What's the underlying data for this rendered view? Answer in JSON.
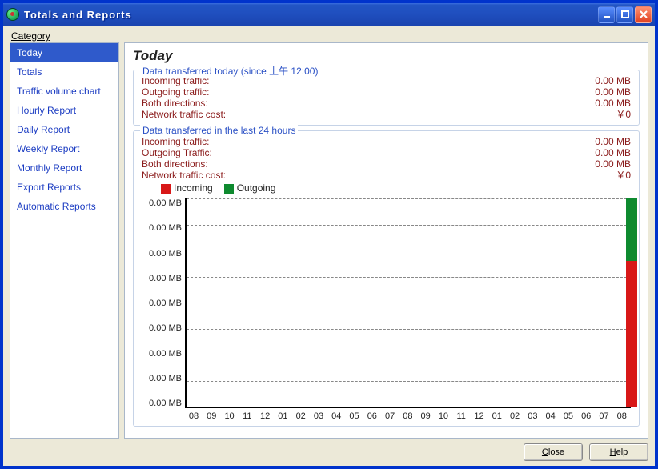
{
  "window": {
    "title": "Totals and Reports"
  },
  "category_label": "Category",
  "sidebar": {
    "items": [
      {
        "label": "Today",
        "selected": true
      },
      {
        "label": "Totals"
      },
      {
        "label": "Traffic volume chart"
      },
      {
        "label": "Hourly Report"
      },
      {
        "label": "Daily Report"
      },
      {
        "label": "Weekly Report"
      },
      {
        "label": "Monthly Report"
      },
      {
        "label": "Export Reports"
      },
      {
        "label": "Automatic Reports"
      }
    ]
  },
  "page": {
    "title": "Today",
    "group_today": {
      "legend": "Data transferred today (since 上午 12:00)",
      "rows": [
        {
          "k": "Incoming traffic:",
          "v": "0.00 MB"
        },
        {
          "k": "Outgoing traffic:",
          "v": "0.00 MB"
        },
        {
          "k": "Both directions:",
          "v": "0.00 MB"
        },
        {
          "k": "Network traffic cost:",
          "v": "￥0"
        }
      ]
    },
    "group_24h": {
      "legend": "Data transferred in the last 24 hours",
      "rows": [
        {
          "k": "Incoming traffic:",
          "v": "0.00 MB"
        },
        {
          "k": "Outgoing Traffic:",
          "v": "0.00 MB"
        },
        {
          "k": "Both directions:",
          "v": "0.00 MB"
        },
        {
          "k": "Network traffic cost:",
          "v": "￥0"
        }
      ]
    },
    "legend": {
      "incoming": "Incoming",
      "outgoing": "Outgoing",
      "incoming_color": "#d81818",
      "outgoing_color": "#0e8a2f"
    }
  },
  "chart_data": {
    "type": "bar",
    "title": "",
    "xlabel": "",
    "ylabel": "",
    "ylim": [
      0,
      0
    ],
    "y_ticks": [
      "0.00 MB",
      "0.00 MB",
      "0.00 MB",
      "0.00 MB",
      "0.00 MB",
      "0.00 MB",
      "0.00 MB",
      "0.00 MB",
      "0.00 MB"
    ],
    "categories": [
      "08",
      "09",
      "10",
      "11",
      "12",
      "01",
      "02",
      "03",
      "04",
      "05",
      "06",
      "07",
      "08",
      "09",
      "10",
      "11",
      "12",
      "01",
      "02",
      "03",
      "04",
      "05",
      "06",
      "07",
      "08"
    ],
    "series": [
      {
        "name": "Incoming",
        "color": "#d81818",
        "values": [
          0,
          0,
          0,
          0,
          0,
          0,
          0,
          0,
          0,
          0,
          0,
          0,
          0,
          0,
          0,
          0,
          0,
          0,
          0,
          0,
          0,
          0,
          0,
          0,
          0
        ]
      },
      {
        "name": "Outgoing",
        "color": "#0e8a2f",
        "values": [
          0,
          0,
          0,
          0,
          0,
          0,
          0,
          0,
          0,
          0,
          0,
          0,
          0,
          0,
          0,
          0,
          0,
          0,
          0,
          0,
          0,
          0,
          0,
          0,
          0
        ]
      }
    ],
    "note": "All y-axis ticks read 0.00 MB and all bars are effectively zero-height; the right-most bar visually shows stacked red (lower ~70%) + green (upper ~30%) in the screenshot but scale is degenerate (0–0)."
  },
  "footer": {
    "close": "Close",
    "help": "Help"
  }
}
